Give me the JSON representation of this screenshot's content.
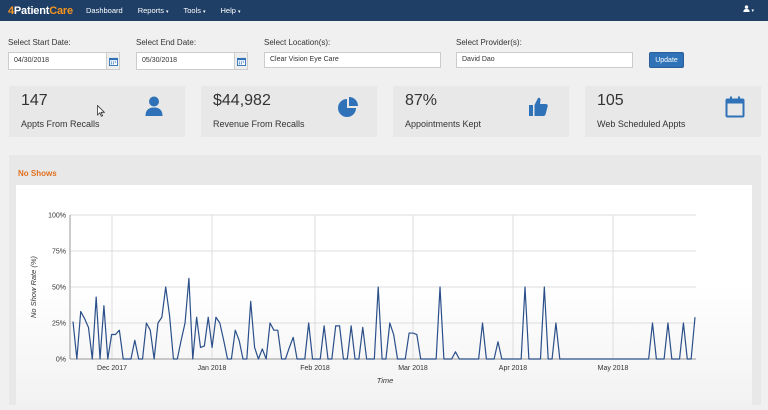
{
  "navbar": {
    "brand_prefix": "4",
    "brand_main": "Patient",
    "brand_suffix": "Care",
    "items": [
      {
        "label": "Dashboard"
      },
      {
        "label": "Reports",
        "caret": "▾"
      },
      {
        "label": "Tools",
        "caret": "▾"
      },
      {
        "label": "Help",
        "caret": "▾"
      }
    ],
    "user_icon": "user-icon",
    "user_caret": "▾"
  },
  "filters": {
    "start_label": "Select Start Date:",
    "start_value": "04/30/2018",
    "end_label": "Select End Date:",
    "end_value": "05/30/2018",
    "location_label": "Select Location(s):",
    "location_value": "Clear Vision Eye Care",
    "provider_label": "Select Provider(s):",
    "provider_value": "David Dao",
    "update_label": "Update",
    "calendar_icon": "calendar-icon"
  },
  "stats": [
    {
      "value": "147",
      "label": "Appts From Recalls",
      "icon": "user-icon"
    },
    {
      "value": "$44,982",
      "label": "Revenue From Recalls",
      "icon": "pie-chart-icon"
    },
    {
      "value": "87%",
      "label": "Appointments Kept",
      "icon": "thumbs-up-icon"
    },
    {
      "value": "105",
      "label": "Web Scheduled Appts",
      "icon": "calendar-icon"
    }
  ],
  "colors": {
    "navbar": "#1f3f66",
    "brand_accent": "#f7941d",
    "title_orange": "#e07020",
    "icon_blue": "#2f72b8",
    "line": "#2b4f8a",
    "button": "#2f72b8"
  },
  "chart": {
    "title": "No Shows",
    "chart_data": {
      "type": "line",
      "title": "No Shows",
      "xlabel": "Time",
      "ylabel": "No Show Rate (%)",
      "ylim": [
        0,
        100
      ],
      "yticks": [
        "0%",
        "25%",
        "50%",
        "75%",
        "100%"
      ],
      "xticks": [
        "Dec 2017",
        "Jan 2018",
        "Feb 2018",
        "Mar 2018",
        "Apr 2018",
        "May 2018"
      ],
      "grid": true,
      "series": [
        {
          "values": [
            26,
            0,
            33,
            28,
            22,
            0,
            43,
            0,
            37,
            0,
            17,
            17,
            20,
            0,
            0,
            0,
            13,
            0,
            0,
            25,
            20,
            0,
            25,
            29,
            50,
            30,
            0,
            0,
            13,
            25,
            56,
            0,
            29,
            8,
            9,
            29,
            8,
            29,
            25,
            13,
            0,
            0,
            20,
            13,
            0,
            0,
            40,
            8,
            0,
            7,
            0,
            25,
            20,
            20,
            0,
            0,
            8,
            15,
            0,
            0,
            0,
            25,
            0,
            0,
            0,
            23,
            0,
            0,
            23,
            23,
            0,
            0,
            23,
            0,
            0,
            22,
            0,
            0,
            0,
            50,
            0,
            0,
            25,
            17,
            0,
            0,
            0,
            18,
            18,
            17,
            0,
            0,
            0,
            0,
            0,
            50,
            0,
            0,
            0,
            5,
            0,
            0,
            0,
            0,
            0,
            0,
            25,
            0,
            0,
            0,
            12,
            0,
            0,
            0,
            0,
            0,
            0,
            50,
            0,
            0,
            0,
            0,
            50,
            0,
            0,
            25,
            0,
            0,
            0,
            0,
            0,
            0,
            0,
            0,
            0,
            0,
            0,
            0,
            0,
            0,
            0,
            0,
            0,
            0,
            0,
            0,
            0,
            0,
            0,
            0,
            25,
            0,
            0,
            0,
            25,
            0,
            0,
            0,
            25,
            0,
            0,
            29
          ]
        }
      ]
    }
  }
}
